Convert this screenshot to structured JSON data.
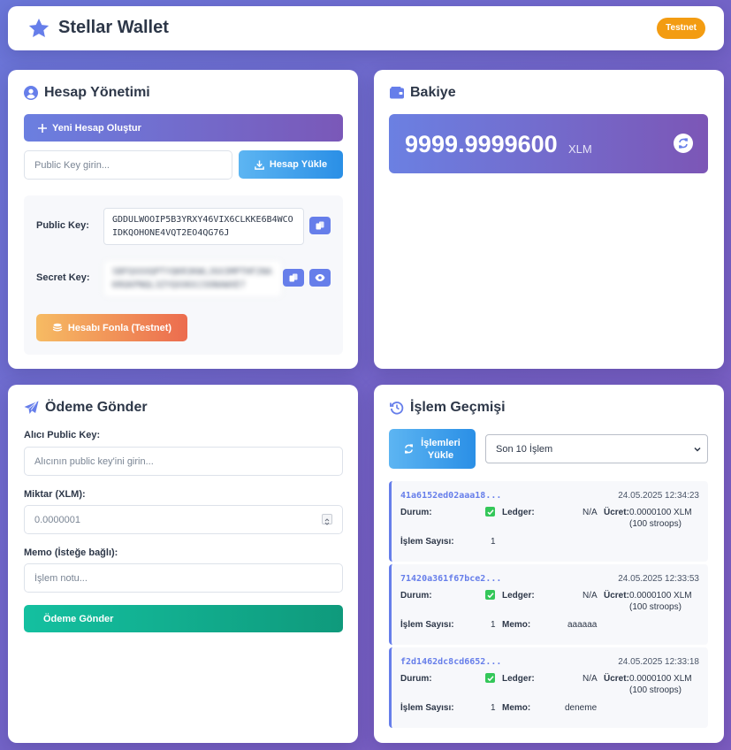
{
  "header": {
    "title": "Stellar Wallet",
    "network_badge": "Testnet"
  },
  "account": {
    "title": "Hesap Yönetimi",
    "create_button": "Yeni Hesap Oluştur",
    "pk_placeholder": "Public Key girin...",
    "load_button": "Hesap Yükle",
    "public_key_label": "Public Key:",
    "public_key_value": "GDDULWOOIP5B3YRXY46VIX6CLKKE6B4WCOIDKQOHONE4VQT2EO4QG76J",
    "secret_key_label": "Secret Key:",
    "secret_key_value": "SBFQXXXQPTYQKR3KWLJ6X3MPTHF2NAKRGKPNQL3ZYQXXKXJ3ONAWXE7",
    "fund_button": "Hesabı Fonla (Testnet)"
  },
  "balance": {
    "title": "Bakiye",
    "amount": "9999.9999600",
    "asset": "XLM"
  },
  "payment": {
    "title": "Ödeme Gönder",
    "recipient_label": "Alıcı Public Key:",
    "recipient_placeholder": "Alıcının public key'ini girin...",
    "amount_label": "Miktar (XLM):",
    "amount_placeholder": "0.0000001",
    "memo_label": "Memo (İsteğe bağlı):",
    "memo_placeholder": "İşlem notu...",
    "send_button": "Ödeme Gönder"
  },
  "history": {
    "title": "İşlem Geçmişi",
    "load_button_line1": "İşlemleri",
    "load_button_line2": "Yükle",
    "select_value": "Son 10 İşlem",
    "labels": {
      "status": "Durum:",
      "ledger": "Ledger:",
      "fee": "Ücret:",
      "ops": "İşlem Sayısı:",
      "memo": "Memo:"
    },
    "transactions": [
      {
        "hash": "41a6152ed02aaa18...",
        "date": "24.05.2025 12:34:23",
        "ledger": "N/A",
        "fee": "0.0000100 XLM",
        "fee_stroops": "(100 stroops)",
        "ops": "1",
        "memo": ""
      },
      {
        "hash": "71420a361f67bce2...",
        "date": "24.05.2025 12:33:53",
        "ledger": "N/A",
        "fee": "0.0000100 XLM",
        "fee_stroops": "(100 stroops)",
        "ops": "1",
        "memo": "aaaaaa"
      },
      {
        "hash": "f2d1462dc8cd6652...",
        "date": "24.05.2025 12:33:18",
        "ledger": "N/A",
        "fee": "0.0000100 XLM",
        "fee_stroops": "(100 stroops)",
        "ops": "1",
        "memo": "deneme"
      }
    ]
  },
  "colors": {
    "accent": "#667eea",
    "badge": "#f39c12",
    "success": "#34c759",
    "send": "#11a98b"
  }
}
